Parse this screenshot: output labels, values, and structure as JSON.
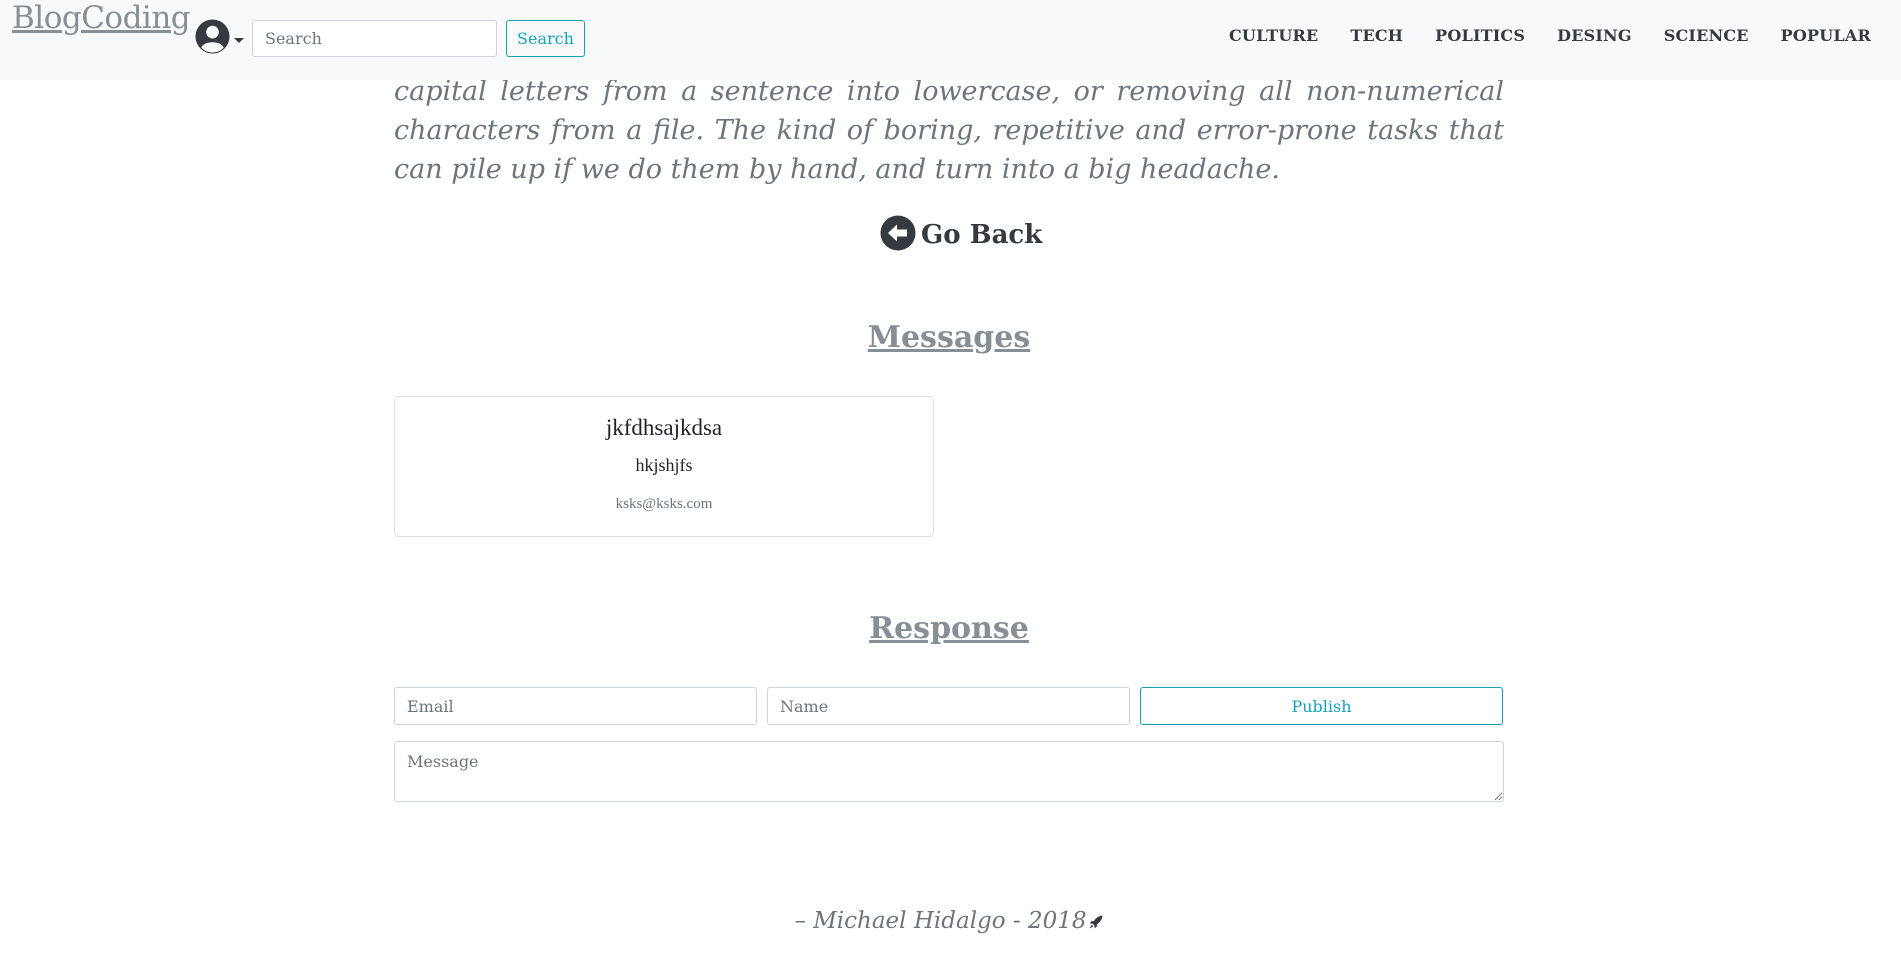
{
  "navbar": {
    "brand": "BlogCoding",
    "user_menu_icon": "user-circle-icon",
    "search": {
      "placeholder": "Search",
      "button_label": "Search"
    },
    "links": [
      "CULTURE",
      "TECH",
      "POLITICS",
      "DESING",
      "SCIENCE",
      "POPULAR"
    ]
  },
  "article": {
    "text": "capital letters from a sentence into lowercase, or removing all non-numerical characters from a file. The kind of boring, repetitive and error-prone tasks that can pile up if we do them by hand, and turn into a big headache."
  },
  "go_back": {
    "label": "Go Back",
    "icon": "arrow-circle-left-icon"
  },
  "messages": {
    "title": "Messages",
    "items": [
      {
        "title": "jkfdhsajkdsa",
        "body": "hkjshjfs",
        "email": "ksks@ksks.com"
      }
    ]
  },
  "response": {
    "title": "Response",
    "email_placeholder": "Email",
    "name_placeholder": "Name",
    "publish_label": "Publish",
    "message_placeholder": "Message"
  },
  "footer": {
    "text": "– Michael Hidalgo - 2018",
    "icon": "rocket-icon"
  },
  "colors": {
    "accent": "#17a2b8",
    "navbar_bg": "#f8f9fa",
    "muted": "#868e96",
    "dark": "#343a40"
  }
}
